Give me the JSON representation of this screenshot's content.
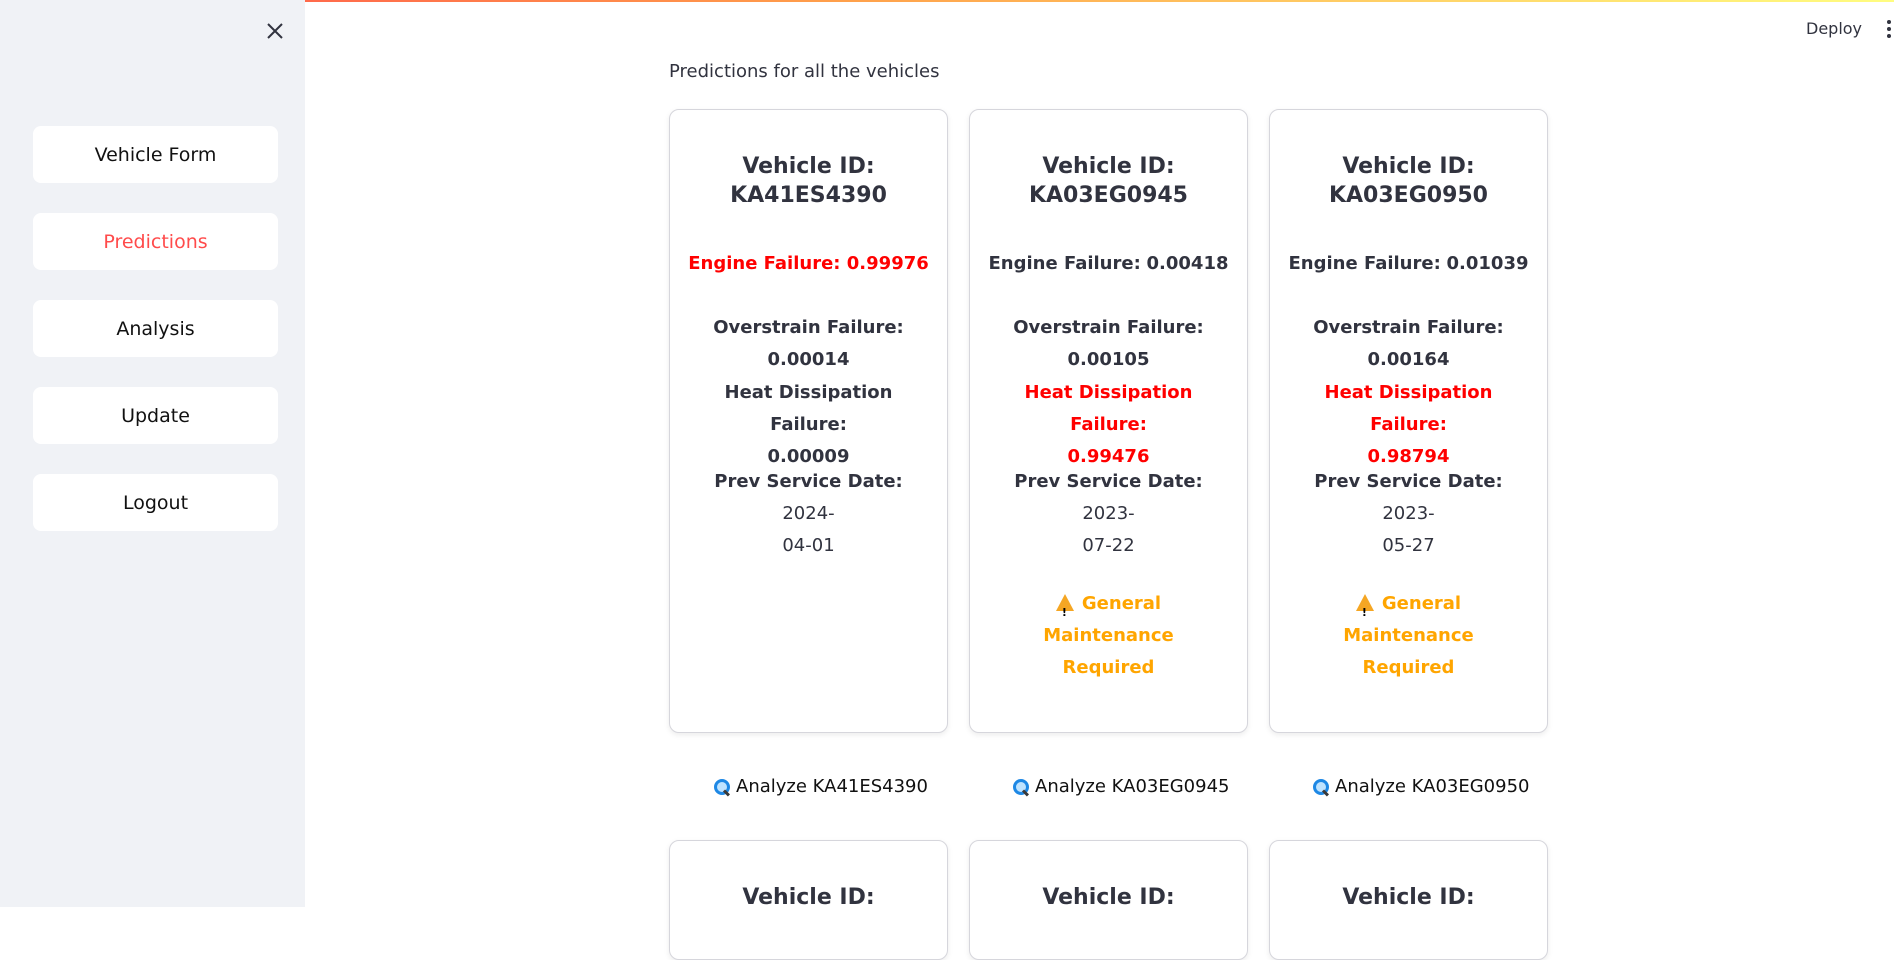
{
  "header": {
    "deploy_label": "Deploy"
  },
  "sidebar": {
    "items": [
      {
        "label": "Vehicle Form",
        "active": false
      },
      {
        "label": "Predictions",
        "active": true
      },
      {
        "label": "Analysis",
        "active": false
      },
      {
        "label": "Update",
        "active": false
      },
      {
        "label": "Logout",
        "active": false
      }
    ]
  },
  "main": {
    "title": "Predictions for all the vehicles",
    "colors": {
      "alert": "#ff0000",
      "warning": "#ffa500",
      "active_nav": "#ff4b4b"
    },
    "cards": [
      {
        "title_prefix": "Vehicle ID:",
        "vehicle_id": "KA41ES4390",
        "engine_label": "Engine Failure:",
        "engine_value": "0.99976",
        "overstrain_label": "Overstrain Failure:",
        "overstrain_value": "0.00014",
        "heat_label": "Heat Dissipation Failure:",
        "heat_value": "0.00009",
        "service_label": "Prev Service Date:",
        "service_date_line1": "2024-",
        "service_date_line2": "04-01",
        "warning_line1": "",
        "warning_line2": "",
        "analyze_label": "Analyze KA41ES4390"
      },
      {
        "title_prefix": "Vehicle ID:",
        "vehicle_id": "KA03EG0945",
        "engine_label": "Engine Failure:",
        "engine_value": "0.00418",
        "overstrain_label": "Overstrain Failure:",
        "overstrain_value": "0.00105",
        "heat_label": "Heat Dissipation Failure:",
        "heat_value": "0.99476",
        "service_label": "Prev Service Date:",
        "service_date_line1": "2023-",
        "service_date_line2": "07-22",
        "warning_line1": "General Maintenance",
        "warning_line2": "Required",
        "analyze_label": "Analyze KA03EG0945"
      },
      {
        "title_prefix": "Vehicle ID:",
        "vehicle_id": "KA03EG0950",
        "engine_label": "Engine Failure:",
        "engine_value": "0.01039",
        "overstrain_label": "Overstrain Failure:",
        "overstrain_value": "0.00164",
        "heat_label": "Heat Dissipation Failure:",
        "heat_value": "0.98794",
        "service_label": "Prev Service Date:",
        "service_date_line1": "2023-",
        "service_date_line2": "05-27",
        "warning_line1": "General Maintenance",
        "warning_line2": "Required",
        "analyze_label": "Analyze KA03EG0950"
      }
    ],
    "next_row_titles": [
      "Vehicle ID:",
      "Vehicle ID:",
      "Vehicle ID:"
    ]
  }
}
